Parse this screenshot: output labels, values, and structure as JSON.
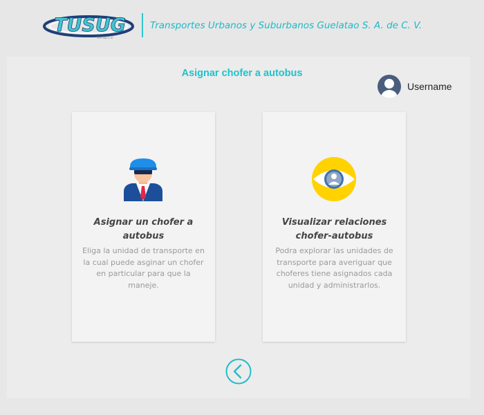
{
  "header": {
    "logo_text": "TUSUG",
    "company_name": "Transportes Urbanos y Suburbanos Guelatao S. A. de C. V."
  },
  "page": {
    "title": "Asignar chofer a autobus"
  },
  "user": {
    "name": "Username",
    "avatar_icon": "user-avatar-icon"
  },
  "cards": [
    {
      "title": "Asignar un chofer a autobus",
      "description": "Eliga la unidad de transporte en la cual puede asginar un chofer en particular para que la maneje.",
      "icon": "driver-icon"
    },
    {
      "title": "Visualizar relaciones chofer-autobus",
      "description": "Podra explorar las unidades de transporte para averiguar que choferes tiene asignados cada unidad y administrarlos.",
      "icon": "eye-icon"
    }
  ],
  "navigation": {
    "back_icon": "chevron-left-icon"
  },
  "colors": {
    "accent": "#1ec3cc",
    "background": "#e7e7e7",
    "card": "#f3f3f3"
  }
}
